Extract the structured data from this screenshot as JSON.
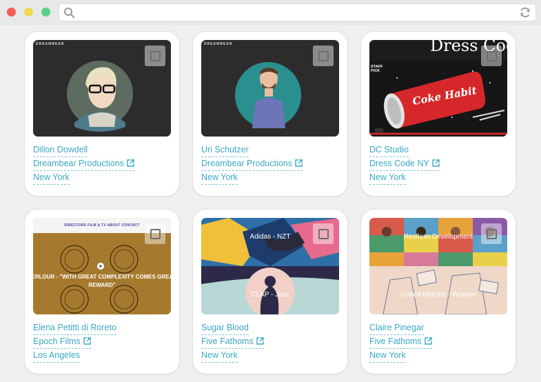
{
  "browser": {
    "url_value": "",
    "search_icon": "search-icon",
    "reload_icon": "reload-icon"
  },
  "colors": {
    "link": "#3aa8c3",
    "window_red": "#f45d5d",
    "window_yellow": "#f2d94e",
    "window_green": "#5bd08f"
  },
  "cards": [
    {
      "name": "Dillon Dowdell",
      "company": "Dreambear Productions",
      "location": "New York",
      "thumb": {
        "logo": "DREAMBEAR"
      }
    },
    {
      "name": "Uri Schutzer",
      "company": "Dreambear Productions",
      "location": "New York",
      "thumb": {
        "logo": "DREAMBEAR"
      }
    },
    {
      "name": "DC Studio",
      "company": "Dress Code NY",
      "location": "New York",
      "thumb": {
        "title": "Dress Code",
        "badge": "STAFF PICK",
        "art_text": "Coke Habit"
      }
    },
    {
      "name": "Elena Petitti di Roreto",
      "company": "Epoch Films",
      "location": "Los Angeles",
      "thumb": {
        "nav": "DIRECTORS   FILM & TV   ABOUT   CONTACT",
        "quote_line1": "ABERLOUR - \"WITH GREAT COMPLEXITY COMES GREAT",
        "quote_line2": "REWARD\""
      }
    },
    {
      "name": "Sugar Blood",
      "company": "Five Fathoms",
      "location": "New York",
      "thumb": {
        "label_top": "Adidas - NZT",
        "label_bottom": "CLAP - Jazz"
      }
    },
    {
      "name": "Claire Pinegar",
      "company": "Five Fathoms",
      "location": "New York",
      "thumb": {
        "label_top": "Restless Development",
        "label_bottom": "United Nations - Women"
      }
    }
  ]
}
